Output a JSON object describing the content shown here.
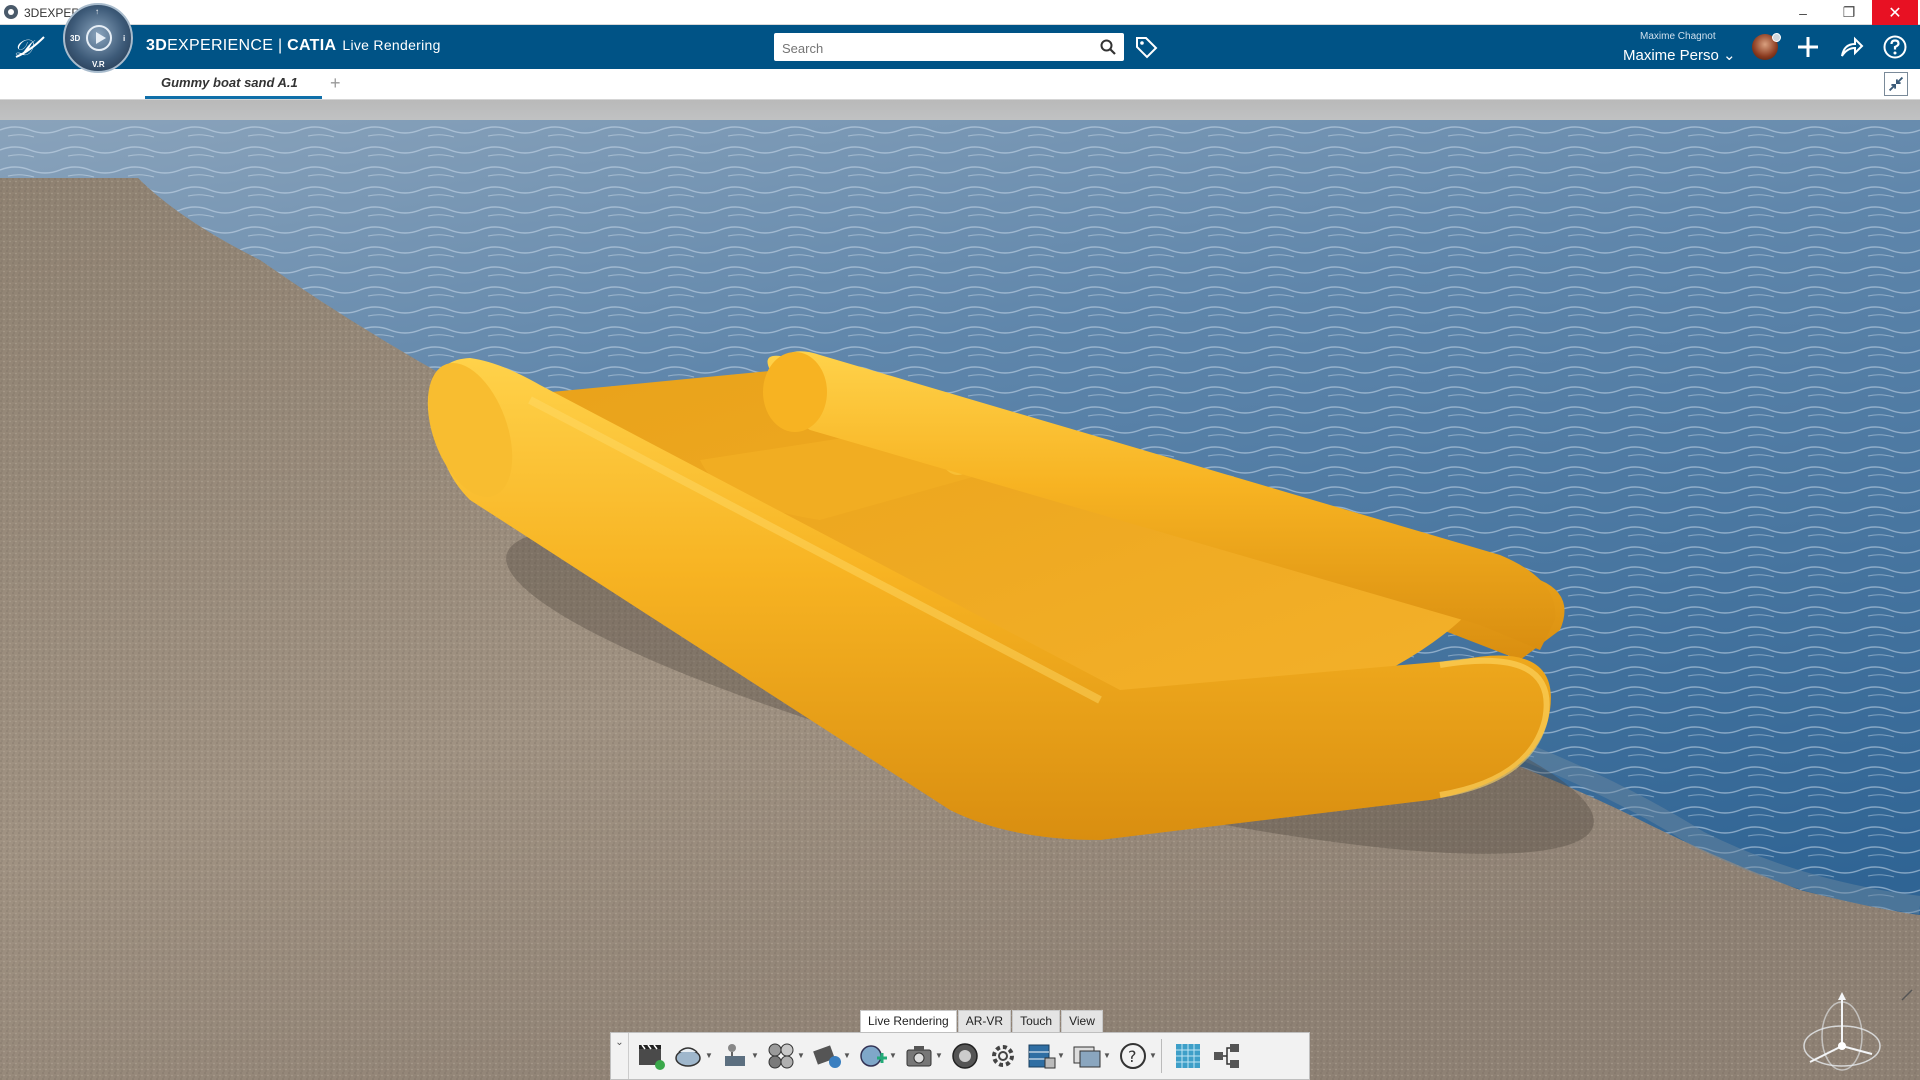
{
  "window": {
    "title": "3DEXPERIENCE",
    "minimize": "–",
    "restore": "❐",
    "close": "✕"
  },
  "header": {
    "brand_bold": "3D",
    "brand_rest": "EXPERIENCE | ",
    "brand_catia": "CATIA",
    "app_name": "Live Rendering",
    "compass_labels": {
      "top": "↑",
      "left": "3D",
      "right": "i",
      "bottom": "V.R"
    },
    "search_placeholder": "Search",
    "user_subtitle": "Maxime Chagnot",
    "user_name": "Maxime Perso ⌄",
    "accent_color": "#005386"
  },
  "tabs": {
    "items": [
      {
        "label": "Gummy boat sand A.1",
        "active": true
      }
    ],
    "add_label": "+"
  },
  "action_bar": {
    "tabs": [
      {
        "label": "Live Rendering",
        "active": true
      },
      {
        "label": "AR-VR",
        "active": false
      },
      {
        "label": "Touch",
        "active": false
      },
      {
        "label": "View",
        "active": false
      }
    ],
    "collapse_label": "⌄",
    "tools": [
      "render-video-icon",
      "environment-icon",
      "lighting-icon",
      "materials-icon",
      "camera-object-icon",
      "add-camera-icon",
      "capture-icon",
      "shutter-icon",
      "settings-icon",
      "database-icon",
      "image-gallery-icon",
      "help-icon",
      "ground-grid-icon",
      "structure-icon"
    ]
  },
  "scene": {
    "sky_color": "#c2c4c6",
    "water_color": "#3f6f9e",
    "sand_color": "#9a8c7c",
    "boat_color": "#f2b01f"
  }
}
